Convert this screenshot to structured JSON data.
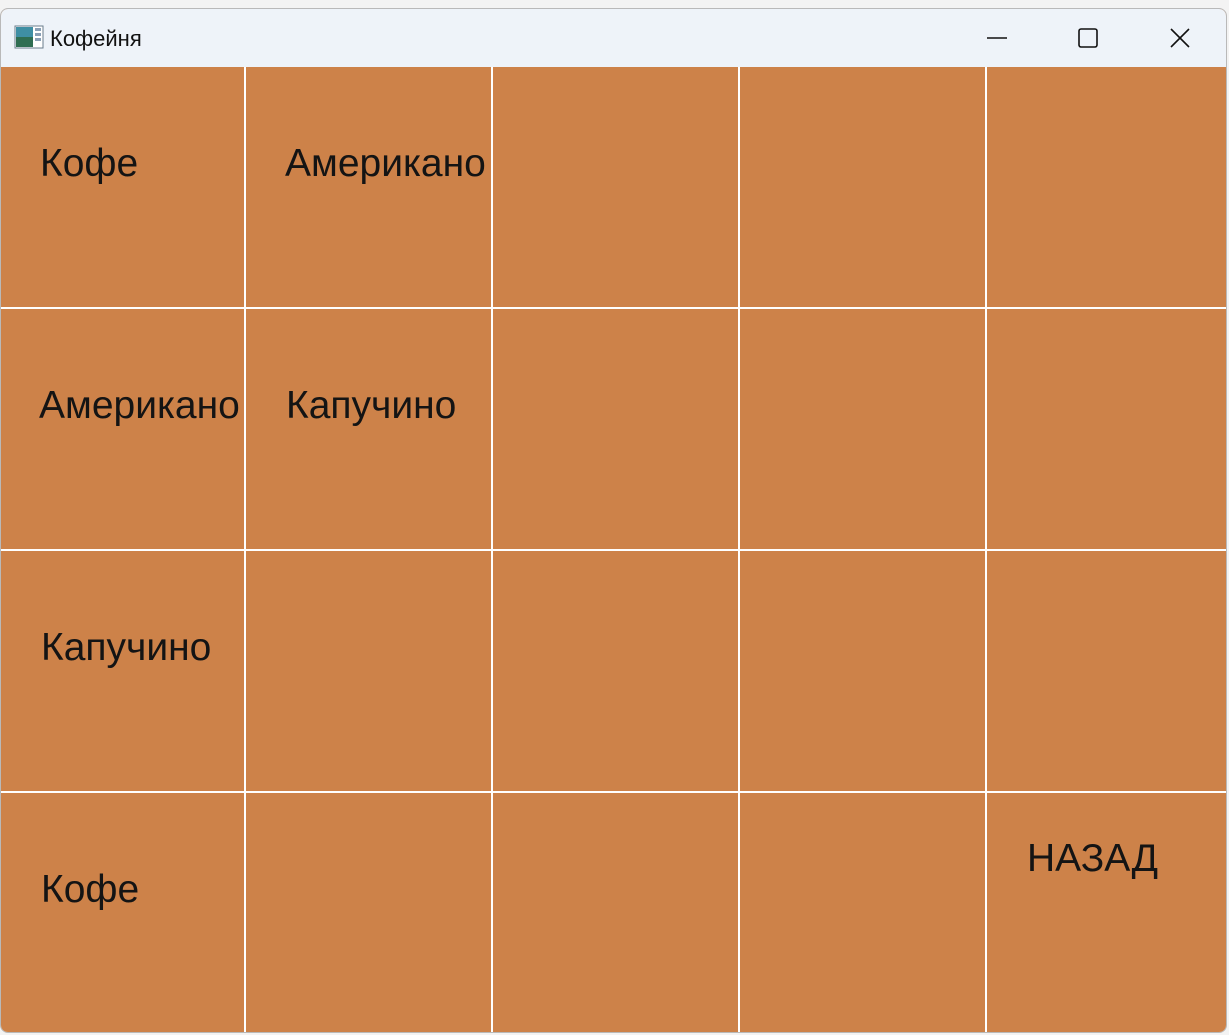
{
  "window": {
    "title": "Кофейня",
    "app_icon": "window-app-icon",
    "background_color": "#cd8249",
    "grid_line_color": "#ffffff"
  },
  "controls": {
    "minimize_icon": "minimize-icon",
    "maximize_icon": "maximize-icon",
    "close_icon": "close-icon"
  },
  "grid": {
    "rows": [
      [
        "Кофе",
        "Американо",
        "",
        "",
        ""
      ],
      [
        "Американо",
        "Капучино",
        "",
        "",
        ""
      ],
      [
        "Капучино",
        "",
        "",
        "",
        ""
      ],
      [
        "Кофе",
        "",
        "",
        "",
        "НАЗАД"
      ]
    ]
  }
}
